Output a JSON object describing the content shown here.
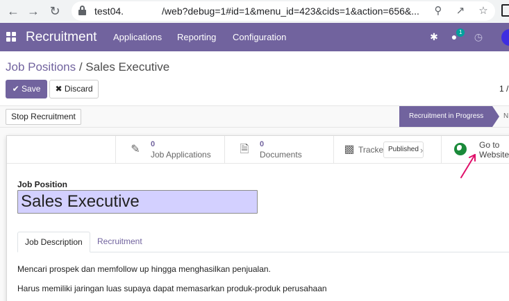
{
  "browser": {
    "url_prefix": "test04.",
    "url_suffix": "/web?debug=1#id=1&menu_id=423&cids=1&action=656&..."
  },
  "navbar": {
    "brand": "Recruitment",
    "menu": [
      "Applications",
      "Reporting",
      "Configuration"
    ],
    "chat_badge": "1"
  },
  "breadcrumb": {
    "parent": "Job Positions",
    "separator": " / ",
    "current": "Sales Executive"
  },
  "buttons": {
    "save": "Save",
    "discard": "Discard",
    "stop": "Stop Recruitment"
  },
  "pager": "1 /",
  "statusbar": {
    "active_stage": "Recruitment in Progress",
    "next_stage": "N"
  },
  "smart_buttons": {
    "applications": {
      "count": "0",
      "label": "Job Applications"
    },
    "documents": {
      "count": "0",
      "label": "Documents"
    },
    "tracker": {
      "label": "Tracke",
      "tag": "Published"
    },
    "website": {
      "line1": "Go to",
      "line2": "Website"
    }
  },
  "form": {
    "job_position_label": "Job Position",
    "job_position_value": "Sales Executive"
  },
  "tabs": [
    "Job Description",
    "Recruitment"
  ],
  "description": [
    "Mencari prospek dan memfollow up hingga menghasilkan penjualan.",
    "Harus memiliki jaringan luas supaya dapat memasarkan produk-produk perusahaan"
  ],
  "colors": {
    "brand": "#71639e",
    "input_highlight": "#d3d0ff",
    "annotation_arrow": "#e0106a"
  }
}
